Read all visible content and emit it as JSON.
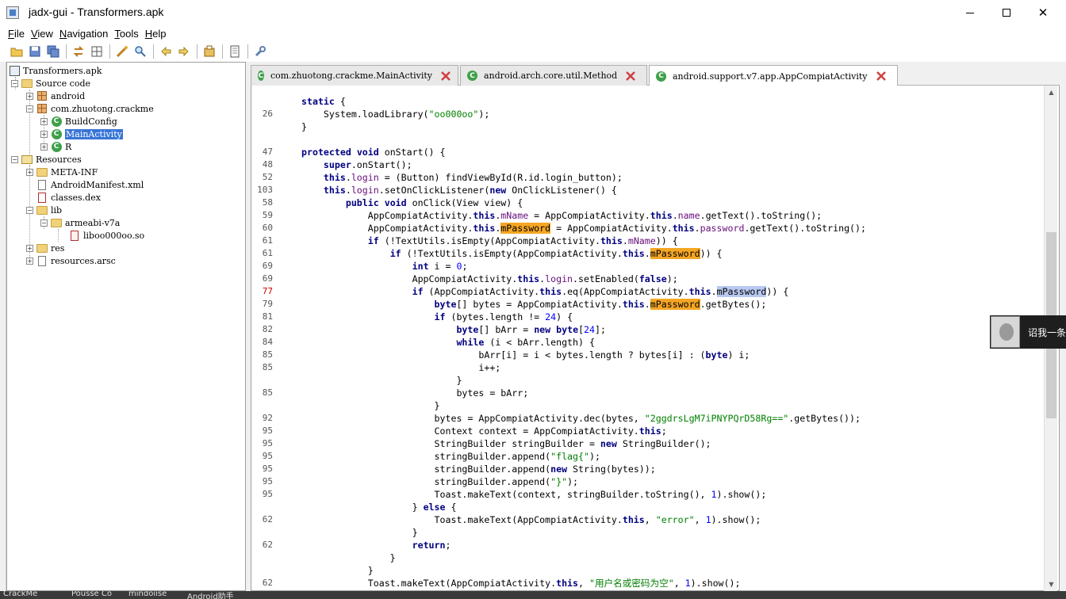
{
  "window": {
    "title": "jadx-gui - Transformers.apk",
    "close_glyph": "✕"
  },
  "menu": [
    {
      "hot": "F",
      "rest": "ile"
    },
    {
      "hot": "V",
      "rest": "iew"
    },
    {
      "hot": "N",
      "rest": "avigation"
    },
    {
      "hot": "T",
      "rest": "ools"
    },
    {
      "hot": "H",
      "rest": "elp"
    }
  ],
  "toolbar": {
    "icons": [
      "open-file-icon",
      "save-icon",
      "save-all-icon",
      "sync-icon",
      "flatten-icon",
      "decompile-icon",
      "search-icon",
      "back-icon",
      "forward-icon",
      "preferences-icon",
      "log-icon",
      "settings-icon"
    ]
  },
  "tree": {
    "root": "Transformers.apk",
    "source_code": "Source code",
    "android": "android",
    "package": "com.zhuotong.crackme",
    "build_config": "BuildConfig",
    "main_activity": "MainActivity",
    "r": "R",
    "resources": "Resources",
    "meta_inf": "META-INF",
    "manifest": "AndroidManifest.xml",
    "classes_dex": "classes.dex",
    "lib": "lib",
    "armeabi": "armeabi-v7a",
    "libso": "liboo000oo.so",
    "res": "res",
    "resources_arsc": "resources.arsc"
  },
  "tabs": [
    {
      "label": "com.zhuotong.crackme.MainActivity"
    },
    {
      "label": "android.arch.core.util.Method"
    },
    {
      "label": "android.support.v7.app.AppCompiatActivity"
    }
  ],
  "code": {
    "lines": [
      {
        "ln": "",
        "html": "<span class='kw'>static</span> {"
      },
      {
        "ln": "26",
        "html": "    System.loadLibrary(<span class='str'>\"oo000oo\"</span>);"
      },
      {
        "ln": "",
        "html": "}"
      },
      {
        "ln": "",
        "html": ""
      },
      {
        "ln": "47",
        "html": "<span class='kw'>protected</span> <span class='kw'>void</span> onStart() {"
      },
      {
        "ln": "48",
        "html": "    <span class='kw'>super</span>.onStart();"
      },
      {
        "ln": "52",
        "html": "    <span class='kw'>this</span>.<span class='fld'>login</span> = (Button) findViewById(R.id.login_button);"
      },
      {
        "ln": "103",
        "html": "    <span class='kw'>this</span>.<span class='fld'>login</span>.setOnClickListener(<span class='kw'>new</span> OnClickListener() {"
      },
      {
        "ln": "58",
        "html": "        <span class='kw'>public</span> <span class='kw'>void</span> onClick(View view) {"
      },
      {
        "ln": "59",
        "html": "            AppCompiatActivity.<span class='kw'>this</span>.<span class='fld'>mName</span> = AppCompiatActivity.<span class='kw'>this</span>.<span class='fld'>name</span>.getText().toString();"
      },
      {
        "ln": "60",
        "html": "            AppCompiatActivity.<span class='kw'>this</span>.<span class='hl'>mPassword</span> = AppCompiatActivity.<span class='kw'>this</span>.<span class='fld'>password</span>.getText().toString();"
      },
      {
        "ln": "61",
        "html": "            <span class='kw'>if</span> (!TextUtils.isEmpty(AppCompiatActivity.<span class='kw'>this</span>.<span class='fld'>mName</span>)) {"
      },
      {
        "ln": "61",
        "html": "                <span class='kw'>if</span> (!TextUtils.isEmpty(AppCompiatActivity.<span class='kw'>this</span>.<span class='hl'>mPassword</span>)) {"
      },
      {
        "ln": "69",
        "html": "                    <span class='kw'>int</span> i = <span class='num'>0</span>;"
      },
      {
        "ln": "69",
        "html": "                    AppCompiatActivity.<span class='kw'>this</span>.<span class='fld'>login</span>.setEnabled(<span class='kw'>false</span>);"
      },
      {
        "ln": "77",
        "hot": true,
        "html": "                    <span class='kw'>if</span> (AppCompiatActivity.<span class='kw'>this</span>.eq(AppCompiatActivity.<span class='kw'>this</span>.<span class='hl2'>mPassword</span>)) {"
      },
      {
        "ln": "79",
        "html": "                        <span class='kw'>byte</span>[] bytes = AppCompiatActivity.<span class='kw'>this</span>.<span class='hl'>mPassword</span>.getBytes();"
      },
      {
        "ln": "81",
        "html": "                        <span class='kw'>if</span> (bytes.length != <span class='num'>24</span>) {"
      },
      {
        "ln": "82",
        "html": "                            <span class='kw'>byte</span>[] bArr = <span class='kw'>new</span> <span class='kw'>byte</span>[<span class='num'>24</span>];"
      },
      {
        "ln": "84",
        "html": "                            <span class='kw'>while</span> (i &lt; bArr.length) {"
      },
      {
        "ln": "85",
        "html": "                                bArr[i] = i &lt; bytes.length ? bytes[i] : (<span class='kw'>byte</span>) i;"
      },
      {
        "ln": "85",
        "html": "                                i++;"
      },
      {
        "ln": "",
        "html": "                            }"
      },
      {
        "ln": "85",
        "html": "                            bytes = bArr;"
      },
      {
        "ln": "",
        "html": "                        }"
      },
      {
        "ln": "92",
        "html": "                        bytes = AppCompiatActivity.dec(bytes, <span class='str'>\"2ggdrsLgM7iPNYPQrD58Rg==\"</span>.getBytes());"
      },
      {
        "ln": "95",
        "html": "                        Context context = AppCompiatActivity.<span class='kw'>this</span>;"
      },
      {
        "ln": "95",
        "html": "                        StringBuilder stringBuilder = <span class='kw'>new</span> StringBuilder();"
      },
      {
        "ln": "95",
        "html": "                        stringBuilder.append(<span class='str'>\"flag{\"</span>);"
      },
      {
        "ln": "95",
        "html": "                        stringBuilder.append(<span class='kw'>new</span> String(bytes));"
      },
      {
        "ln": "95",
        "html": "                        stringBuilder.append(<span class='str'>\"}\"</span>);"
      },
      {
        "ln": "95",
        "html": "                        Toast.makeText(context, stringBuilder.toString(), <span class='num'>1</span>).show();"
      },
      {
        "ln": "",
        "html": "                    } <span class='kw'>else</span> {"
      },
      {
        "ln": "62",
        "html": "                        Toast.makeText(AppCompiatActivity.<span class='kw'>this</span>, <span class='str'>\"error\"</span>, <span class='num'>1</span>).show();"
      },
      {
        "ln": "",
        "html": "                    }"
      },
      {
        "ln": "62",
        "html": "                    <span class='kw'>return</span>;"
      },
      {
        "ln": "",
        "html": "                }"
      },
      {
        "ln": "",
        "html": "            }"
      },
      {
        "ln": "62",
        "html": "            Toast.makeText(AppCompiatActivity.<span class='kw'>this</span>, <span class='str'>\"用户名或密码为空\"</span>, <span class='num'>1</span>).show();"
      }
    ]
  },
  "overlay": {
    "text": "诏我一条"
  },
  "taskbar": [
    "CrackMe",
    "Pousse Co",
    "mindoiise",
    "Android助手"
  ]
}
